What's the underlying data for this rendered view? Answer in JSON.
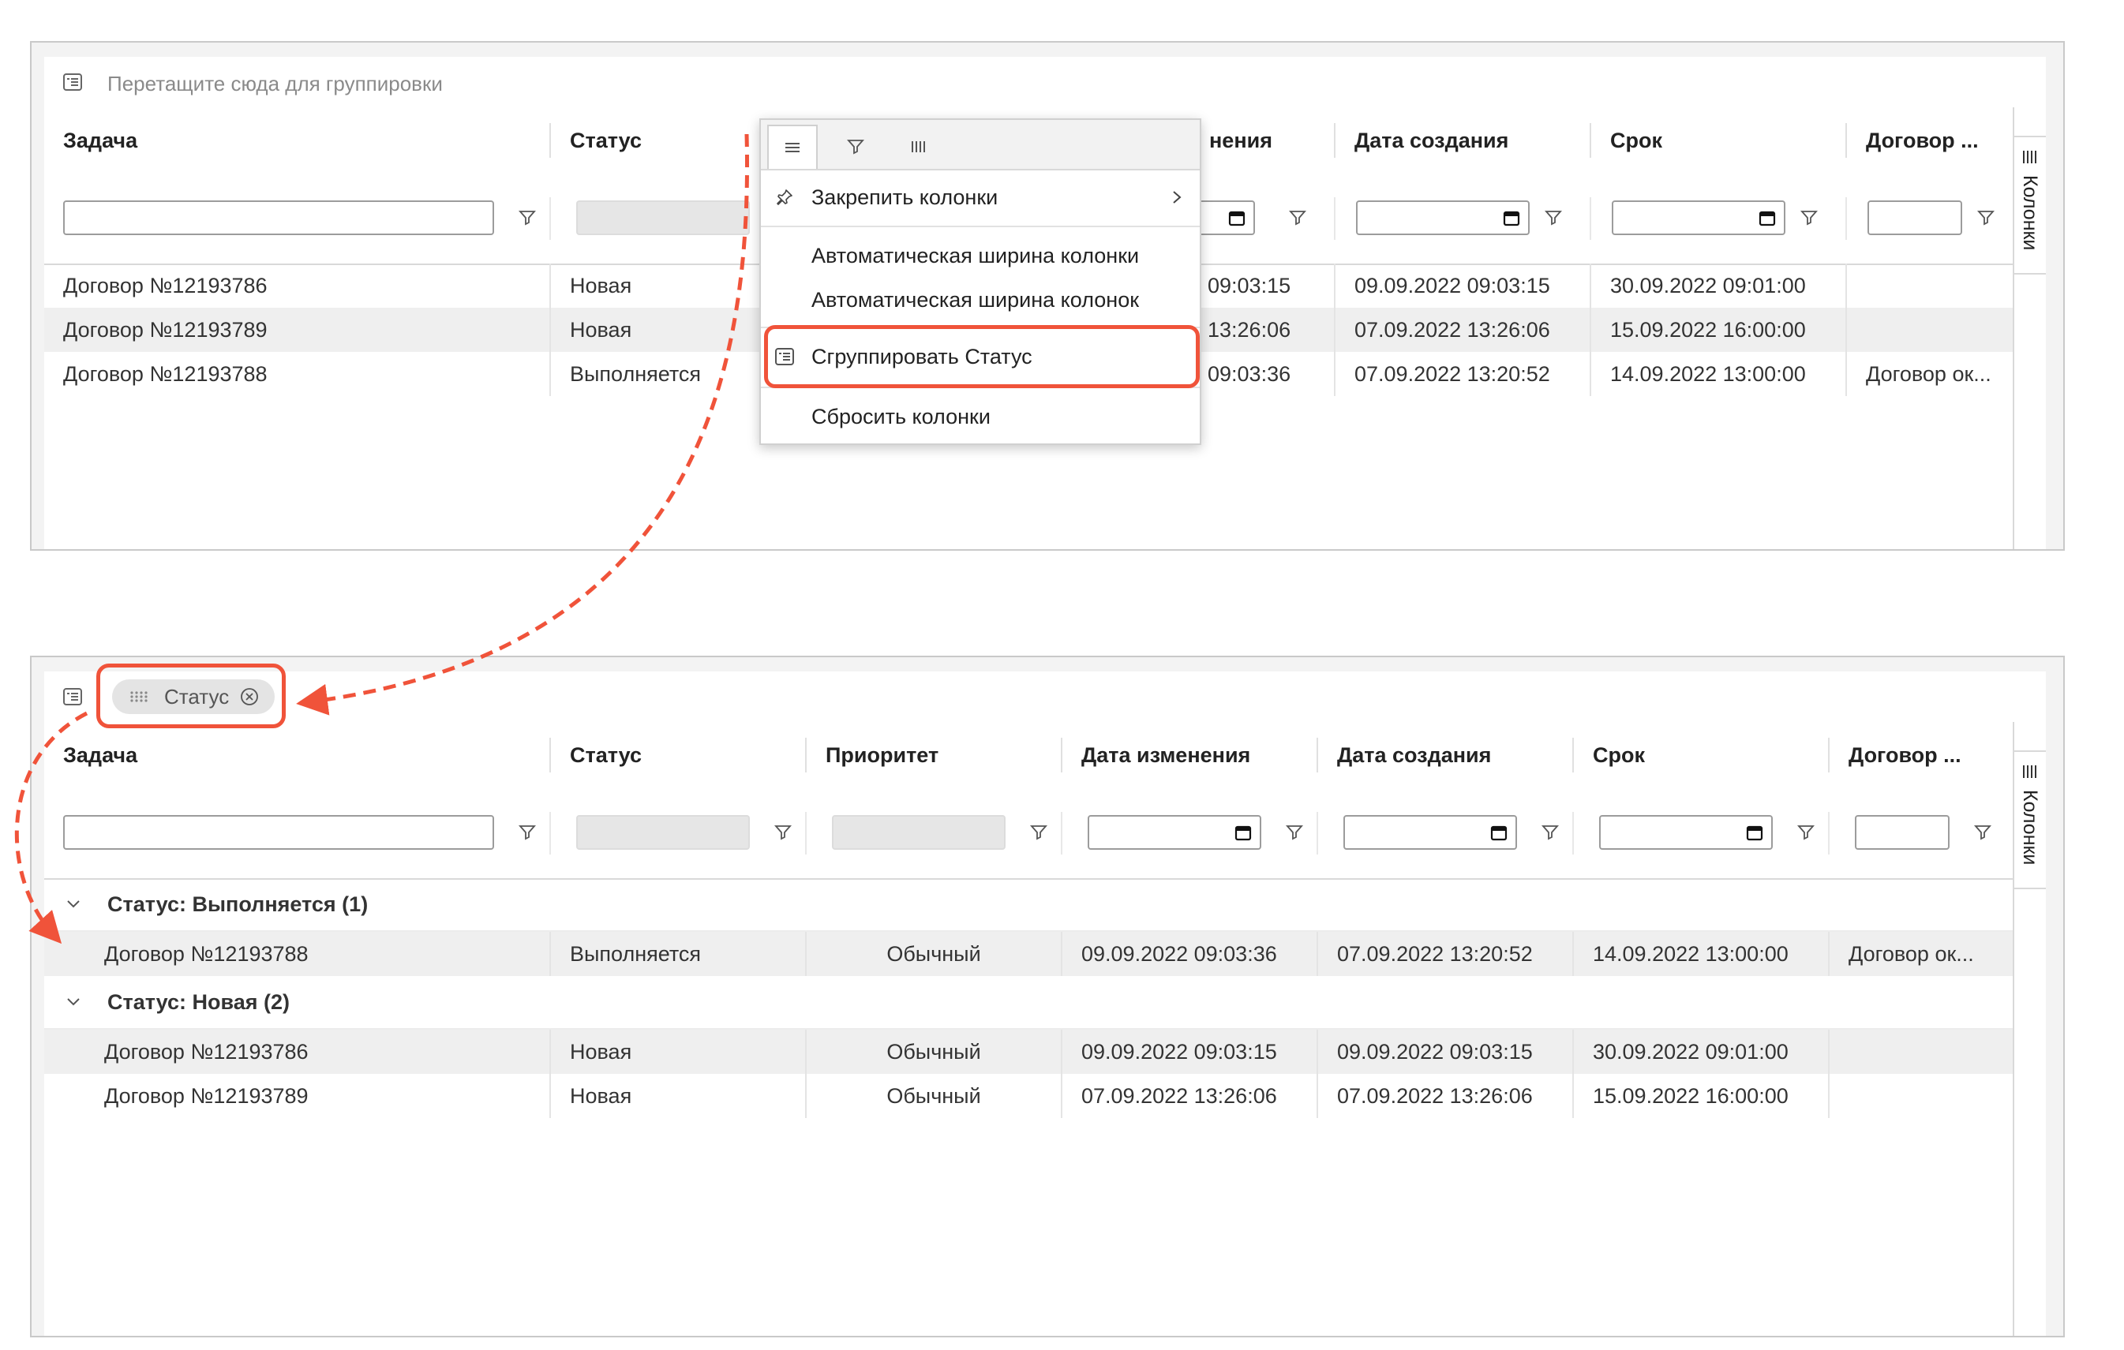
{
  "top_grid": {
    "group_placeholder": "Перетащите сюда для группировки",
    "columns": {
      "task": "Задача",
      "status": "Статус",
      "changed": "нения",
      "created": "Дата создания",
      "due": "Срок",
      "contract": "Договор ..."
    },
    "rows": [
      {
        "task": "Договор №12193786",
        "status": "Новая",
        "changed": "09:03:15",
        "created": "09.09.2022 09:03:15",
        "due": "30.09.2022 09:01:00",
        "contract": ""
      },
      {
        "task": "Договор №12193789",
        "status": "Новая",
        "changed": "13:26:06",
        "created": "07.09.2022 13:26:06",
        "due": "15.09.2022 16:00:00",
        "contract": ""
      },
      {
        "task": "Договор №12193788",
        "status": "Выполняется",
        "changed": "09:03:36",
        "created": "07.09.2022 13:20:52",
        "due": "14.09.2022 13:00:00",
        "contract": "Договор ок..."
      }
    ],
    "side_label": "Колонки"
  },
  "context_menu": {
    "items": [
      {
        "label": "Закрепить колонки"
      },
      {
        "label": "Автоматическая ширина колонки"
      },
      {
        "label": "Автоматическая ширина колонок"
      },
      {
        "label": "Сгруппировать Статус"
      },
      {
        "label": "Сбросить колонки"
      }
    ]
  },
  "bottom_grid": {
    "group_chip": "Статус",
    "columns": {
      "task": "Задача",
      "status": "Статус",
      "priority": "Приоритет",
      "changed": "Дата изменения",
      "created": "Дата создания",
      "due": "Срок",
      "contract": "Договор ..."
    },
    "groups": [
      {
        "label": "Статус: Выполняется (1)",
        "rows": [
          {
            "task": "Договор №12193788",
            "status": "Выполняется",
            "priority": "Обычный",
            "changed": "09.09.2022 09:03:36",
            "created": "07.09.2022 13:20:52",
            "due": "14.09.2022 13:00:00",
            "contract": "Договор ок..."
          }
        ]
      },
      {
        "label": "Статус: Новая (2)",
        "rows": [
          {
            "task": "Договор №12193786",
            "status": "Новая",
            "priority": "Обычный",
            "changed": "09.09.2022 09:03:15",
            "created": "09.09.2022 09:03:15",
            "due": "30.09.2022 09:01:00",
            "contract": ""
          },
          {
            "task": "Договор №12193789",
            "status": "Новая",
            "priority": "Обычный",
            "changed": "07.09.2022 13:26:06",
            "created": "07.09.2022 13:26:06",
            "due": "15.09.2022 16:00:00",
            "contract": ""
          }
        ]
      }
    ],
    "side_label": "Колонки"
  },
  "colors": {
    "highlight": "#f0533a",
    "zebra": "#efefef",
    "border": "#c9c9c9"
  },
  "icons": [
    "group-by-icon",
    "filter-icon",
    "calendar-icon",
    "menu-icon",
    "columns-icon",
    "pin-icon",
    "chevron-right-icon",
    "chevron-down-icon",
    "drag-handle-icon",
    "remove-circle-icon"
  ]
}
